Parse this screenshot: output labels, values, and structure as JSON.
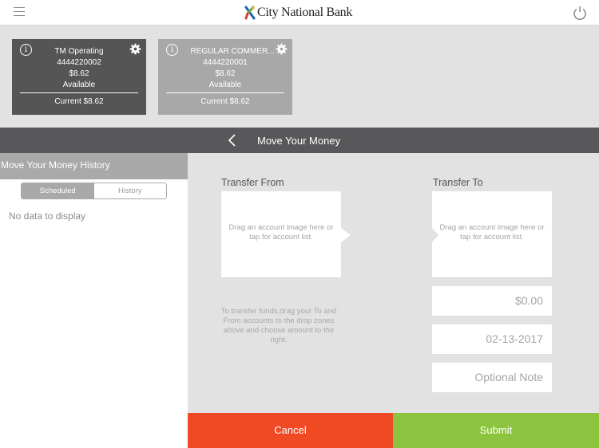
{
  "header": {
    "menu_icon": "hamburger-icon",
    "brand": "City National Bank",
    "logo_icon": "city-national-bank-logo",
    "power_icon": "power-icon"
  },
  "accounts": [
    {
      "name": "TM Operating",
      "number": "4444220002",
      "available_amount": "$8.62",
      "available_label": "Available",
      "current": "Current $8.62",
      "selected": true
    },
    {
      "name": "REGULAR COMMER...",
      "number": "4444220001",
      "available_amount": "$8.62",
      "available_label": "Available",
      "current": "Current $8.62",
      "selected": false
    }
  ],
  "titlebar": {
    "back_icon": "chevron-left-icon",
    "title": "Move Your Money"
  },
  "history_panel": {
    "title": "Move Your Money History",
    "tabs": [
      {
        "label": "Scheduled",
        "active": true
      },
      {
        "label": "History",
        "active": false
      }
    ],
    "empty_text": "No data to display"
  },
  "transfer": {
    "from_label": "Transfer From",
    "to_label": "Transfer To",
    "drop_hint": "Drag an account image here or tap for account list.",
    "instructions": "To transfer funds,drag your To and From accounts to the drop zones above and choose amount to the right.",
    "amount_value": "$0.00",
    "date_value": "02-13-2017",
    "note_placeholder": "Optional Note"
  },
  "actions": {
    "cancel_label": "Cancel",
    "submit_label": "Submit"
  },
  "colors": {
    "cancel": "#f04a25",
    "submit": "#8cc43f",
    "titlebar": "#58585a",
    "selected_card": "#555556",
    "unselected_card": "#a8a8a8"
  }
}
